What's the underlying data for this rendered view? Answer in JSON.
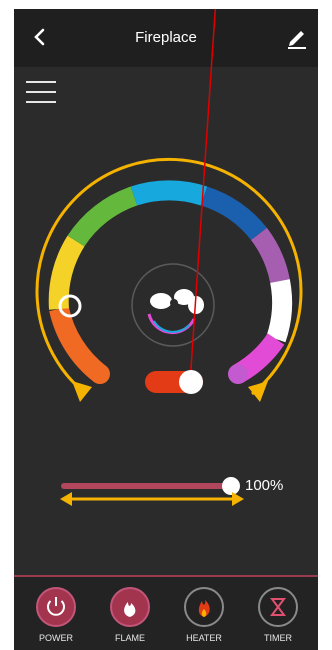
{
  "header": {
    "title": "Fireplace"
  },
  "dial": {
    "ring_colors": [
      "#f06a24",
      "#f5d228",
      "#64b83c",
      "#17a9dd",
      "#1b5faf",
      "#a65fb0",
      "#ffffff",
      "#e24bd6"
    ],
    "accent_arrow_color": "#f5b300"
  },
  "brightness": {
    "value_label": "100%",
    "level": 1.0
  },
  "nav": {
    "items": [
      {
        "label": "POWER",
        "icon": "power-icon"
      },
      {
        "label": "FLAME",
        "icon": "flame-icon"
      },
      {
        "label": "HEATER",
        "icon": "heater-icon"
      },
      {
        "label": "TIMER",
        "icon": "timer-icon"
      }
    ]
  },
  "annotation": {
    "pointer_color": "#e00000"
  }
}
